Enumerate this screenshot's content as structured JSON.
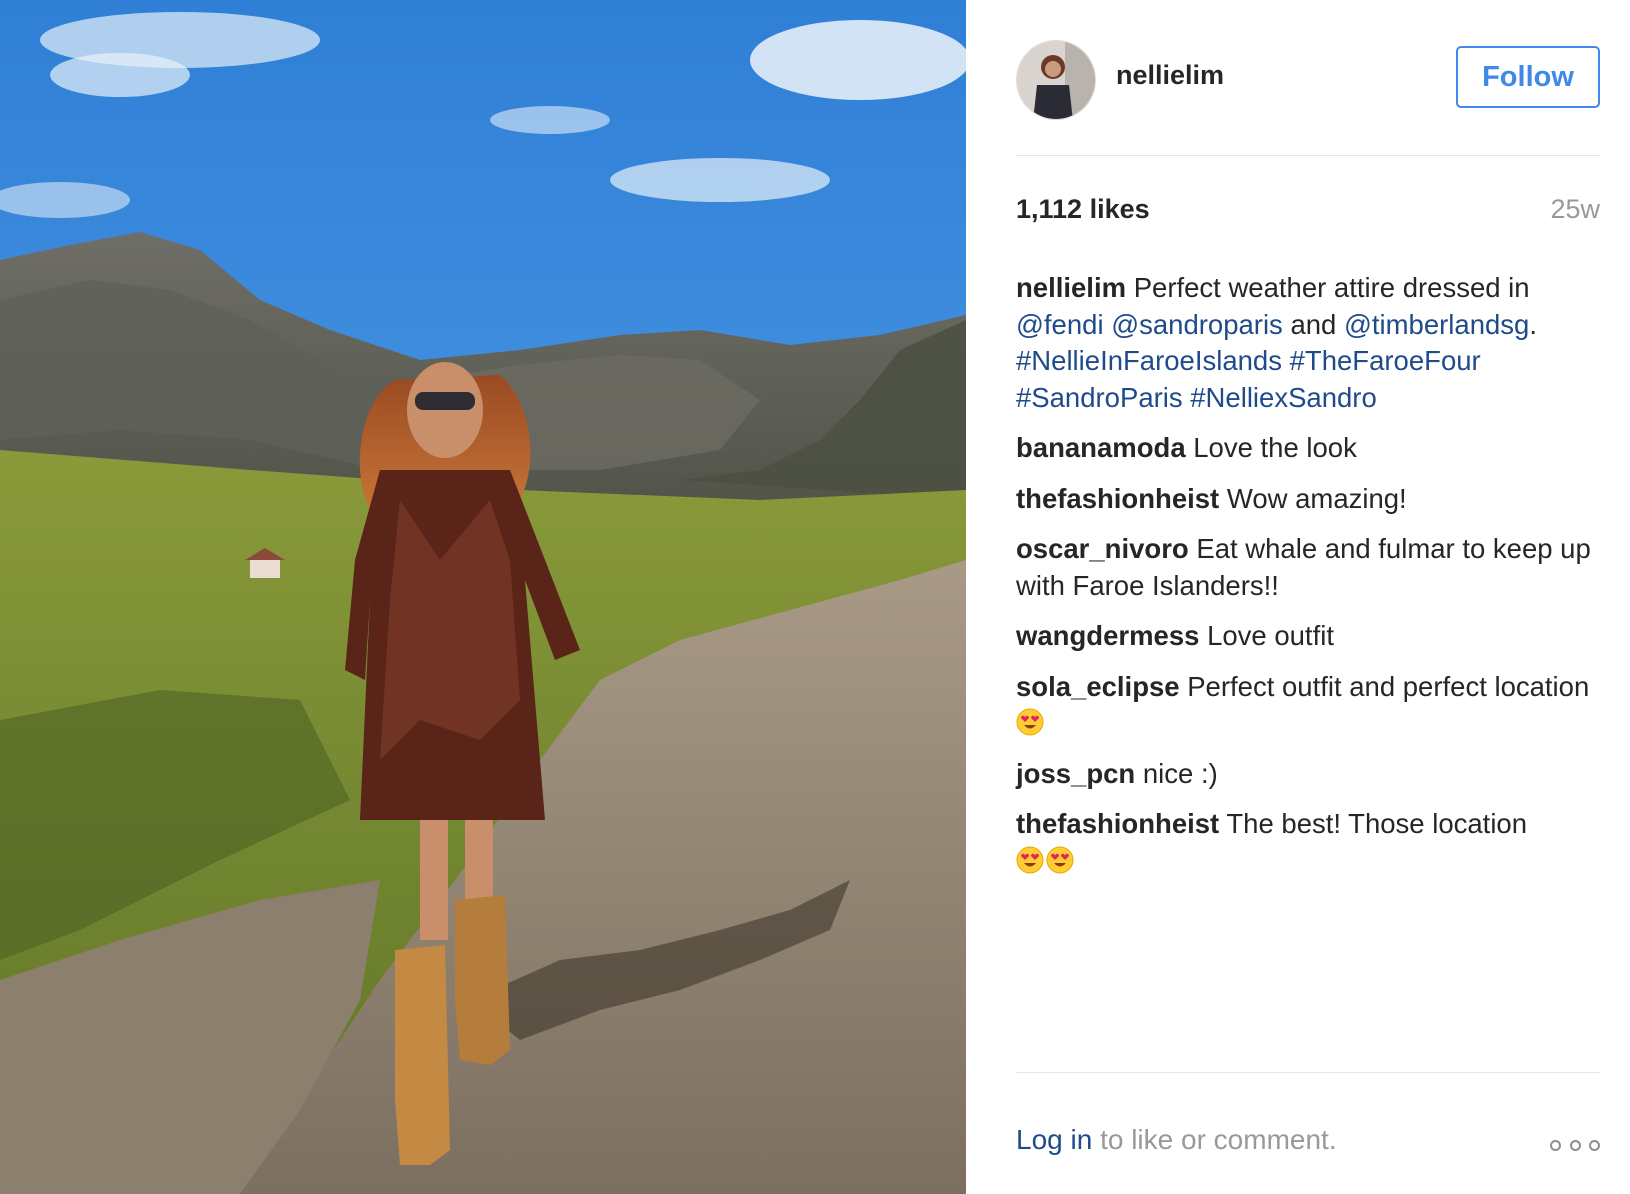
{
  "post": {
    "photo_icon": "fashion-photo-woman-walking-faroe-islands",
    "avatar_icon": "profile-avatar",
    "username": "nellielim",
    "follow_label": "Follow",
    "likes": "1,112 likes",
    "time": "25w"
  },
  "caption": {
    "author": "nellielim",
    "text_1": "Perfect weather attire dressed in",
    "mention_1": "@fendi",
    "mention_2": "@sandroparis",
    "text_and": "and",
    "mention_3": "@timberlandsg",
    "text_period": ".",
    "hashtag_1": "#NellieInFaroeIslands",
    "hashtag_2": "#TheFaroeFour",
    "hashtag_3": "#SandroParis",
    "hashtag_4": "#NelliexSandro"
  },
  "comments": [
    {
      "author": "bananamoda",
      "text": "Love the look"
    },
    {
      "author": "thefashionheist",
      "text": "Wow amazing!"
    },
    {
      "author": "oscar_nivoro",
      "text": "Eat whale and fulmar to keep up with Faroe Islanders!!"
    },
    {
      "author": "wangdermess",
      "text": "Love outfit"
    },
    {
      "author": "sola_eclipse",
      "text": "Perfect outfit and perfect location",
      "emoji": "heart-eyes-emoji"
    },
    {
      "author": "joss_pcn",
      "text": "nice :)"
    },
    {
      "author": "thefashionheist",
      "text": "The best! Those location",
      "emoji": "heart-eyes-emoji"
    }
  ],
  "footer": {
    "login_label": "Log in",
    "login_suffix": "to like or comment.",
    "more_icon": "more-options-icon"
  },
  "colors": {
    "link": "#1f4b8a",
    "follow": "#3f8ae8",
    "muted": "#999999",
    "text": "#262626"
  }
}
